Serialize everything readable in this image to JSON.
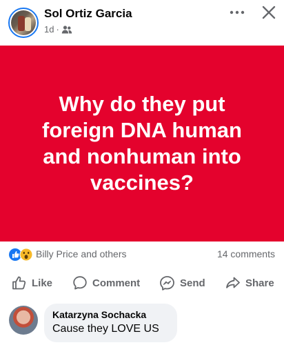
{
  "post": {
    "author": "Sol Ortiz Garcia",
    "time": "1d",
    "separator": "·",
    "privacy_icon": "friends-icon",
    "banner_text": "Why do they put foreign DNA human and nonhuman into vaccines?",
    "banner_color": "#e4022d"
  },
  "reactions": {
    "icons": [
      "like-icon",
      "wow-icon"
    ],
    "names": "Billy Price and others",
    "comments": "14 comments"
  },
  "actions": {
    "like": "Like",
    "comment": "Comment",
    "send": "Send",
    "share": "Share"
  },
  "comment": {
    "author": "Katarzyna Sochacka",
    "text": "Cause they LOVE US"
  }
}
